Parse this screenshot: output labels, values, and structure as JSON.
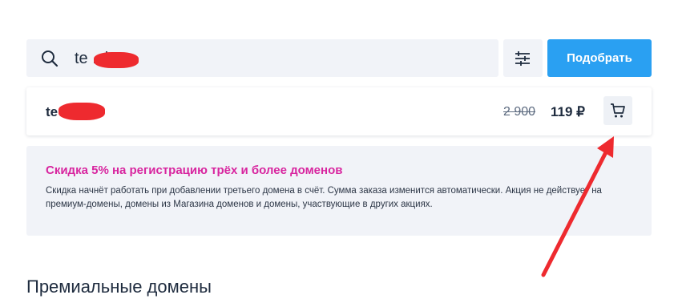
{
  "search": {
    "value": "te        .site"
  },
  "filter_button": {
    "icon": "sliders-icon"
  },
  "pick_button": {
    "label": "Подобрать"
  },
  "result": {
    "domain": "te        .site",
    "old_price": "2 900",
    "new_price": "119 ₽",
    "cart_icon": "cart-icon"
  },
  "promo": {
    "title": "Скидка 5% на регистрацию трёх и более доменов",
    "text": "Скидка начнёт работать при добавлении третьего домена в счёт. Сумма заказа изменится автоматически. Акция не действует на премиум-домены, домены из Магазина доменов и домены, участвующие в других акциях."
  },
  "premium": {
    "title": "Премиальные домены"
  },
  "colors": {
    "accent": "#2aa0f2",
    "promo_title": "#d8259f",
    "annotation": "#ee2a2f"
  }
}
